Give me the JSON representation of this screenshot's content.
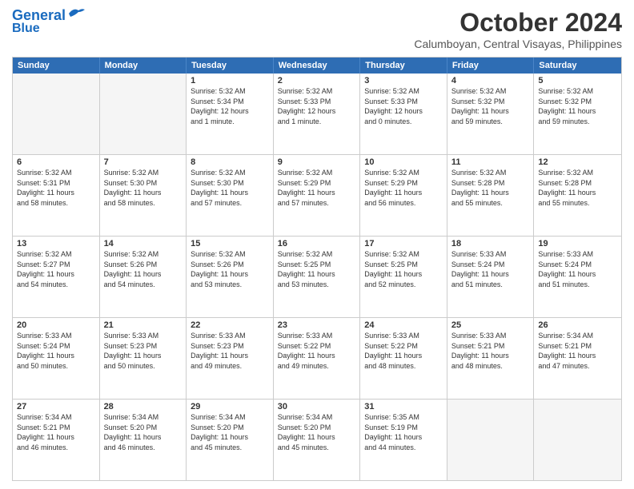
{
  "header": {
    "logo_line1": "General",
    "logo_line2": "Blue",
    "month": "October 2024",
    "location": "Calumboyan, Central Visayas, Philippines"
  },
  "weekdays": [
    "Sunday",
    "Monday",
    "Tuesday",
    "Wednesday",
    "Thursday",
    "Friday",
    "Saturday"
  ],
  "rows": [
    [
      {
        "day": "",
        "info": "",
        "empty": true
      },
      {
        "day": "",
        "info": "",
        "empty": true
      },
      {
        "day": "1",
        "info": "Sunrise: 5:32 AM\nSunset: 5:34 PM\nDaylight: 12 hours\nand 1 minute."
      },
      {
        "day": "2",
        "info": "Sunrise: 5:32 AM\nSunset: 5:33 PM\nDaylight: 12 hours\nand 1 minute."
      },
      {
        "day": "3",
        "info": "Sunrise: 5:32 AM\nSunset: 5:33 PM\nDaylight: 12 hours\nand 0 minutes."
      },
      {
        "day": "4",
        "info": "Sunrise: 5:32 AM\nSunset: 5:32 PM\nDaylight: 11 hours\nand 59 minutes."
      },
      {
        "day": "5",
        "info": "Sunrise: 5:32 AM\nSunset: 5:32 PM\nDaylight: 11 hours\nand 59 minutes."
      }
    ],
    [
      {
        "day": "6",
        "info": "Sunrise: 5:32 AM\nSunset: 5:31 PM\nDaylight: 11 hours\nand 58 minutes."
      },
      {
        "day": "7",
        "info": "Sunrise: 5:32 AM\nSunset: 5:30 PM\nDaylight: 11 hours\nand 58 minutes."
      },
      {
        "day": "8",
        "info": "Sunrise: 5:32 AM\nSunset: 5:30 PM\nDaylight: 11 hours\nand 57 minutes."
      },
      {
        "day": "9",
        "info": "Sunrise: 5:32 AM\nSunset: 5:29 PM\nDaylight: 11 hours\nand 57 minutes."
      },
      {
        "day": "10",
        "info": "Sunrise: 5:32 AM\nSunset: 5:29 PM\nDaylight: 11 hours\nand 56 minutes."
      },
      {
        "day": "11",
        "info": "Sunrise: 5:32 AM\nSunset: 5:28 PM\nDaylight: 11 hours\nand 55 minutes."
      },
      {
        "day": "12",
        "info": "Sunrise: 5:32 AM\nSunset: 5:28 PM\nDaylight: 11 hours\nand 55 minutes."
      }
    ],
    [
      {
        "day": "13",
        "info": "Sunrise: 5:32 AM\nSunset: 5:27 PM\nDaylight: 11 hours\nand 54 minutes."
      },
      {
        "day": "14",
        "info": "Sunrise: 5:32 AM\nSunset: 5:26 PM\nDaylight: 11 hours\nand 54 minutes."
      },
      {
        "day": "15",
        "info": "Sunrise: 5:32 AM\nSunset: 5:26 PM\nDaylight: 11 hours\nand 53 minutes."
      },
      {
        "day": "16",
        "info": "Sunrise: 5:32 AM\nSunset: 5:25 PM\nDaylight: 11 hours\nand 53 minutes."
      },
      {
        "day": "17",
        "info": "Sunrise: 5:32 AM\nSunset: 5:25 PM\nDaylight: 11 hours\nand 52 minutes."
      },
      {
        "day": "18",
        "info": "Sunrise: 5:33 AM\nSunset: 5:24 PM\nDaylight: 11 hours\nand 51 minutes."
      },
      {
        "day": "19",
        "info": "Sunrise: 5:33 AM\nSunset: 5:24 PM\nDaylight: 11 hours\nand 51 minutes."
      }
    ],
    [
      {
        "day": "20",
        "info": "Sunrise: 5:33 AM\nSunset: 5:24 PM\nDaylight: 11 hours\nand 50 minutes."
      },
      {
        "day": "21",
        "info": "Sunrise: 5:33 AM\nSunset: 5:23 PM\nDaylight: 11 hours\nand 50 minutes."
      },
      {
        "day": "22",
        "info": "Sunrise: 5:33 AM\nSunset: 5:23 PM\nDaylight: 11 hours\nand 49 minutes."
      },
      {
        "day": "23",
        "info": "Sunrise: 5:33 AM\nSunset: 5:22 PM\nDaylight: 11 hours\nand 49 minutes."
      },
      {
        "day": "24",
        "info": "Sunrise: 5:33 AM\nSunset: 5:22 PM\nDaylight: 11 hours\nand 48 minutes."
      },
      {
        "day": "25",
        "info": "Sunrise: 5:33 AM\nSunset: 5:21 PM\nDaylight: 11 hours\nand 48 minutes."
      },
      {
        "day": "26",
        "info": "Sunrise: 5:34 AM\nSunset: 5:21 PM\nDaylight: 11 hours\nand 47 minutes."
      }
    ],
    [
      {
        "day": "27",
        "info": "Sunrise: 5:34 AM\nSunset: 5:21 PM\nDaylight: 11 hours\nand 46 minutes."
      },
      {
        "day": "28",
        "info": "Sunrise: 5:34 AM\nSunset: 5:20 PM\nDaylight: 11 hours\nand 46 minutes."
      },
      {
        "day": "29",
        "info": "Sunrise: 5:34 AM\nSunset: 5:20 PM\nDaylight: 11 hours\nand 45 minutes."
      },
      {
        "day": "30",
        "info": "Sunrise: 5:34 AM\nSunset: 5:20 PM\nDaylight: 11 hours\nand 45 minutes."
      },
      {
        "day": "31",
        "info": "Sunrise: 5:35 AM\nSunset: 5:19 PM\nDaylight: 11 hours\nand 44 minutes."
      },
      {
        "day": "",
        "info": "",
        "empty": true
      },
      {
        "day": "",
        "info": "",
        "empty": true
      }
    ]
  ]
}
